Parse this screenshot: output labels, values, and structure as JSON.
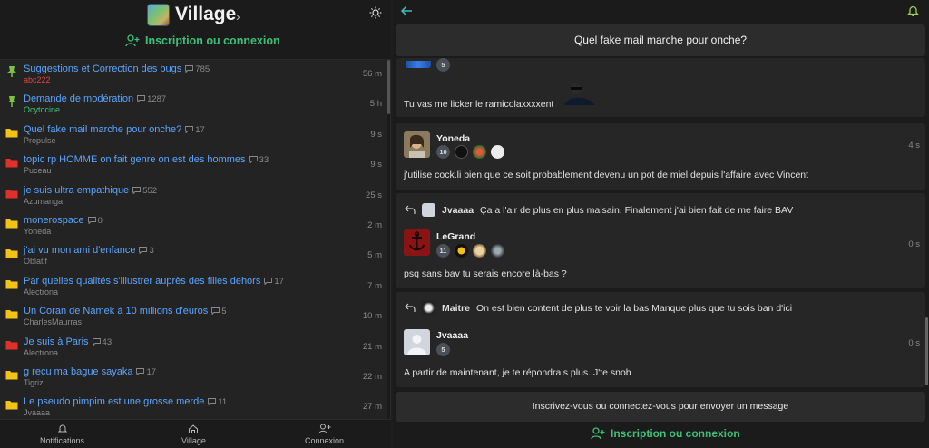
{
  "header": {
    "title": "Village",
    "login_label": "Inscription ou connexion"
  },
  "topics": [
    {
      "title": "Suggestions et Correction des bugs",
      "count": "785",
      "author": "abc222",
      "time": "56 m",
      "icon": "pin-icon",
      "author_color": "red"
    },
    {
      "title": "Demande de modération",
      "count": "1287",
      "author": "Ocytocine",
      "time": "5 h",
      "icon": "pin-icon",
      "author_color": "green"
    },
    {
      "title": "Quel fake mail marche pour onche?",
      "count": "17",
      "author": "Propulse",
      "time": "9 s",
      "icon": "folder-yellow-icon"
    },
    {
      "title": "topic rp HOMME on fait genre on est des hommes",
      "count": "33",
      "author": "Puceau",
      "time": "9 s",
      "icon": "folder-red-icon"
    },
    {
      "title": "je suis ultra empathique",
      "count": "552",
      "author": "Azumanga",
      "time": "25 s",
      "icon": "folder-red-icon"
    },
    {
      "title": "monerospace",
      "count": "0",
      "author": "Yoneda",
      "time": "2 m",
      "icon": "folder-yellow-icon"
    },
    {
      "title": "j'ai vu mon ami d'enfance",
      "count": "3",
      "author": "Oblatif",
      "time": "5 m",
      "icon": "folder-yellow-icon"
    },
    {
      "title": "Par quelles qualités s'illustrer auprès des filles dehors",
      "count": "17",
      "author": "Alectrona",
      "time": "7 m",
      "icon": "folder-yellow-icon"
    },
    {
      "title": "Un Coran de Namek à 10 millions d'euros",
      "count": "5",
      "author": "CharlesMaurras",
      "time": "10 m",
      "icon": "folder-yellow-icon"
    },
    {
      "title": "Je suis à Paris",
      "count": "43",
      "author": "Alectrona",
      "time": "21 m",
      "icon": "folder-red-icon"
    },
    {
      "title": "g recu ma bague sayaka",
      "count": "17",
      "author": "Tigriz",
      "time": "22 m",
      "icon": "folder-yellow-icon"
    },
    {
      "title": "Le pseudo pimpim est une grosse merde",
      "count": "11",
      "author": "Jvaaaa",
      "time": "27 m",
      "icon": "folder-yellow-icon"
    }
  ],
  "bottom_nav": {
    "notifications": "Notifications",
    "village": "Village",
    "connexion": "Connexion"
  },
  "thread": {
    "title": "Quel fake mail marche pour onche?",
    "partial_level": "5",
    "partial_text": "Tu vas me licker le ramicolaxxxxent",
    "messages": [
      {
        "author": "Yoneda",
        "level": "10",
        "time": "4 s",
        "text": "j'utilise cock.li bien que ce soit probablement devenu un pot de miel depuis l'affaire avec Vincent"
      },
      {
        "quote_author": "Jvaaaa",
        "quote_text": "Ça a l'air de plus en plus malsain. Finalement j'ai bien fait de me faire BAV",
        "author": "LeGrand",
        "level": "11",
        "time": "0 s",
        "text": "psq sans bav tu serais encore là-bas ?"
      },
      {
        "quote_author": "Maitre",
        "quote_text": "On est bien content de plus te voir la bas  Manque plus que tu sois ban d'ici",
        "author": "Jvaaaa",
        "level": "5",
        "time": "0 s",
        "text": "A partir de maintenant, je te répondrais plus. J'te snob"
      }
    ],
    "signup_prompt": "Inscrivez-vous ou connectez-vous pour envoyer un message",
    "login_label": "Inscription ou connexion"
  },
  "colors": {
    "accent_green": "#3ec07a",
    "link_blue": "#5aa5ff",
    "folder_yellow": "#f2c316",
    "folder_red": "#e0302a",
    "pin_green": "#7cc142"
  }
}
